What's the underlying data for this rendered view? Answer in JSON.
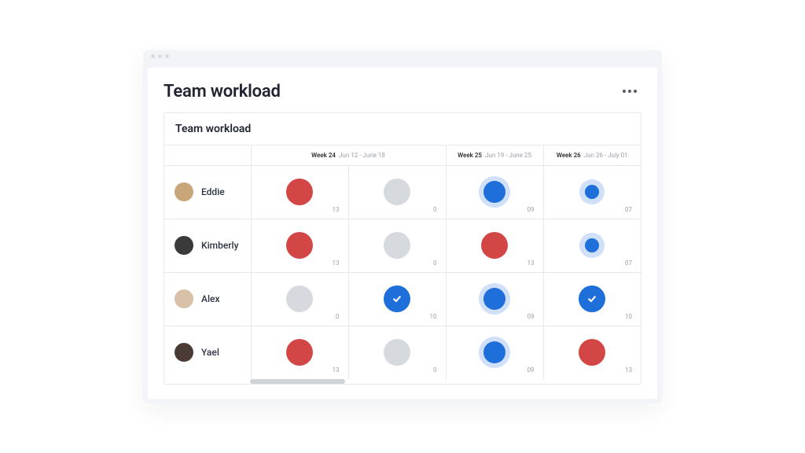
{
  "header": {
    "title": "Team workload"
  },
  "card": {
    "title": "Team workload"
  },
  "columns": [
    {
      "week": "Week 24",
      "range": "Jun 12 - June 18"
    },
    {
      "week": "Week 25",
      "range": "Jun 19 - June 25"
    },
    {
      "week": "Week 26",
      "range": "Jun 26 - July 01"
    }
  ],
  "members": [
    {
      "name": "Eddie",
      "avatar_bg": "#c9a57a",
      "cells": [
        {
          "style": "red",
          "count": "13"
        },
        {
          "style": "grey",
          "count": "0"
        },
        {
          "style": "blue-ring",
          "count": "09"
        },
        {
          "style": "blue-ring-small",
          "count": "07"
        }
      ]
    },
    {
      "name": "Kimberly",
      "avatar_bg": "#3a3a3a",
      "cells": [
        {
          "style": "red",
          "count": "13"
        },
        {
          "style": "grey",
          "count": "0"
        },
        {
          "style": "red",
          "count": "13"
        },
        {
          "style": "blue-ring-small",
          "count": "07"
        }
      ]
    },
    {
      "name": "Alex",
      "avatar_bg": "#d9c0a8",
      "cells": [
        {
          "style": "grey",
          "count": "0"
        },
        {
          "style": "blue-check",
          "count": "10"
        },
        {
          "style": "blue-ring",
          "count": "09"
        },
        {
          "style": "blue-check",
          "count": "10"
        }
      ]
    },
    {
      "name": "Yael",
      "avatar_bg": "#4a3c34",
      "cells": [
        {
          "style": "red",
          "count": "13"
        },
        {
          "style": "grey",
          "count": "0"
        },
        {
          "style": "blue-ring",
          "count": "09"
        },
        {
          "style": "red",
          "count": "13"
        }
      ]
    }
  ],
  "scroll": {
    "left_pct": 18,
    "width_pct": 20
  }
}
